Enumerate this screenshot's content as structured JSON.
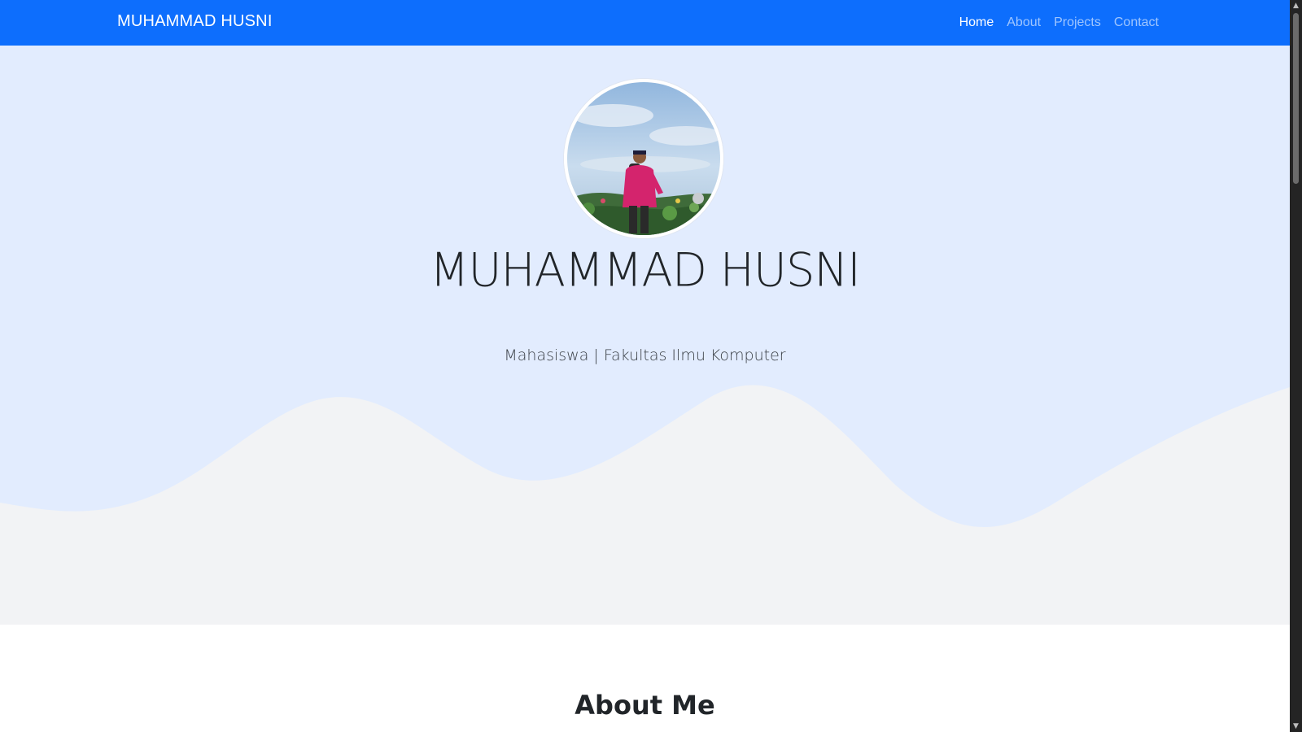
{
  "navbar": {
    "brand": "MUHAMMAD HUSNI",
    "links": [
      {
        "label": "Home",
        "active": true
      },
      {
        "label": "About",
        "active": false
      },
      {
        "label": "Projects",
        "active": false
      },
      {
        "label": "Contact",
        "active": false
      }
    ],
    "color": "#0d6efd"
  },
  "hero": {
    "title": "MUHAMMAD HUSNI",
    "subtitle": "Mahasiswa | Fakultas Ilmu Komputer",
    "background": "#e2ecfe",
    "wave_color": "#f2f3f5",
    "avatar_icon": "profile-photo"
  },
  "about": {
    "title": "About Me"
  },
  "scrollbar": {
    "up_icon": "chevron-up-icon",
    "down_icon": "chevron-down-icon"
  }
}
